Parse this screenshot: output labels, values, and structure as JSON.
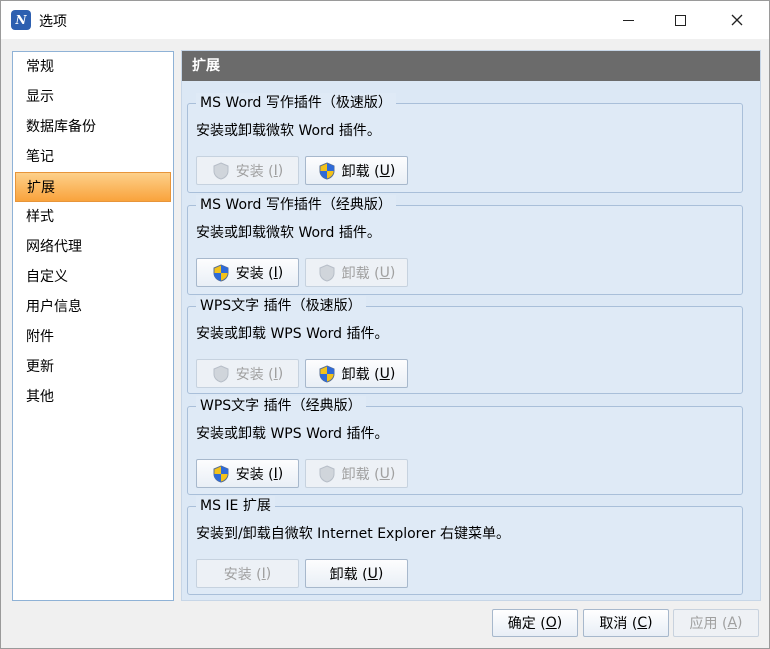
{
  "window": {
    "title": "选项",
    "icon_label": "N"
  },
  "nav": {
    "items": [
      {
        "label": "常规"
      },
      {
        "label": "显示"
      },
      {
        "label": "数据库备份"
      },
      {
        "label": "笔记"
      },
      {
        "label": "扩展"
      },
      {
        "label": "样式"
      },
      {
        "label": "网络代理"
      },
      {
        "label": "自定义"
      },
      {
        "label": "用户信息"
      },
      {
        "label": "附件"
      },
      {
        "label": "更新"
      },
      {
        "label": "其他"
      }
    ],
    "selected_index": 4
  },
  "content": {
    "header": "扩展",
    "groups": [
      {
        "title": "MS Word 写作插件（极速版）",
        "desc": "安装或卸载微软 Word 插件。",
        "install": {
          "label": "安装 (",
          "key": "I",
          "end": ")",
          "enabled": false
        },
        "uninstall": {
          "label": "卸载 (",
          "key": "U",
          "end": ")",
          "enabled": true
        }
      },
      {
        "title": "MS Word 写作插件（经典版）",
        "desc": "安装或卸载微软 Word 插件。",
        "install": {
          "label": "安装 (",
          "key": "I",
          "end": ")",
          "enabled": true
        },
        "uninstall": {
          "label": "卸载 (",
          "key": "U",
          "end": ")",
          "enabled": false
        }
      },
      {
        "title": "WPS文字 插件（极速版）",
        "desc": "安装或卸载 WPS Word 插件。",
        "install": {
          "label": "安装 (",
          "key": "I",
          "end": ")",
          "enabled": false
        },
        "uninstall": {
          "label": "卸载 (",
          "key": "U",
          "end": ")",
          "enabled": true
        }
      },
      {
        "title": "WPS文字 插件（经典版）",
        "desc": "安装或卸载 WPS Word 插件。",
        "install": {
          "label": "安装 (",
          "key": "I",
          "end": ")",
          "enabled": true
        },
        "uninstall": {
          "label": "卸载 (",
          "key": "U",
          "end": ")",
          "enabled": false
        }
      },
      {
        "title": "MS IE 扩展",
        "desc": "安装到/卸载自微软 Internet Explorer 右键菜单。",
        "install": {
          "label": "安装 (",
          "key": "I",
          "end": ")",
          "enabled": false
        },
        "uninstall": {
          "label": "卸载 (",
          "key": "U",
          "end": ")",
          "enabled": true
        }
      }
    ]
  },
  "footer": {
    "ok": {
      "label": "确定 (",
      "key": "O",
      "end": ")"
    },
    "cancel": {
      "label": "取消 (",
      "key": "C",
      "end": ")"
    },
    "apply": {
      "label": "应用 (",
      "key": "A",
      "end": ")"
    }
  },
  "colors": {
    "nav_selected": "#f9a33c",
    "header_bg": "#6b6b6b",
    "content_bg": "#dce8f5"
  },
  "icons": {
    "app": "notebook-app-icon",
    "shield": "uac-shield-icon",
    "minimize": "minimize-icon",
    "maximize": "maximize-icon",
    "close": "close-icon"
  }
}
